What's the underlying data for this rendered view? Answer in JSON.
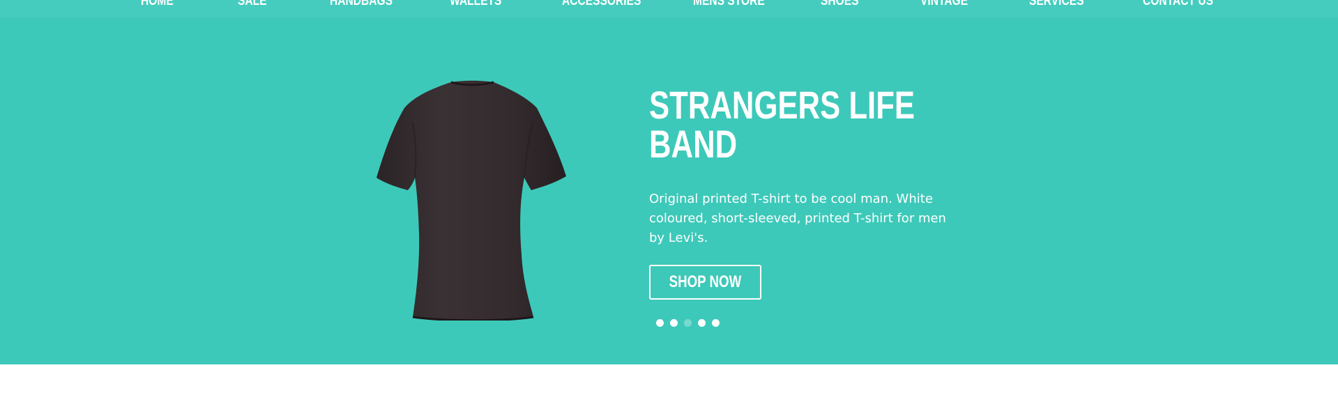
{
  "nav": {
    "items": [
      {
        "label": "HOME"
      },
      {
        "label": "SALE"
      },
      {
        "label": "HANDBAGS"
      },
      {
        "label": "WALLETS"
      },
      {
        "label": "ACCESSORIES"
      },
      {
        "label": "MENS STORE"
      },
      {
        "label": "SHOES"
      },
      {
        "label": "VINTAGE"
      },
      {
        "label": "SERVICES"
      },
      {
        "label": "CONTACT US"
      }
    ]
  },
  "hero": {
    "title_line1": "STRANGERS LIFE",
    "title_line2": "BAND",
    "description": "Original printed T-shirt to be cool man. White coloured, short-sleeved, printed T-shirt for men by Levi's.",
    "button_label": "SHOP NOW",
    "image": "black-tshirt-back",
    "slides": 5,
    "active_slide": 3
  },
  "colors": {
    "accent": "#3dc9b9",
    "nav_bg": "#46ccbe",
    "text": "#ffffff",
    "active_dot": "#7ad9cf"
  }
}
